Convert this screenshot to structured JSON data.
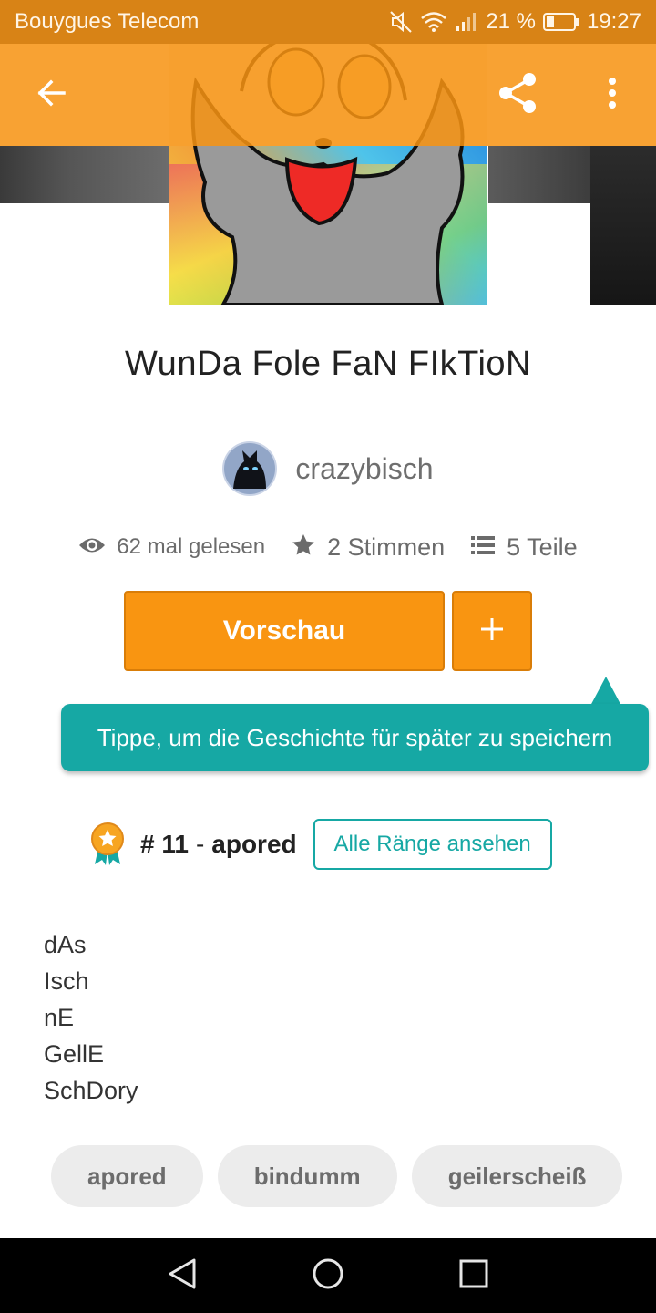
{
  "status_bar": {
    "carrier": "Bouygues Telecom",
    "battery_percent": "21 %",
    "time": "19:27"
  },
  "toolbar": {
    "back_icon": "arrow-left-icon",
    "share_icon": "share-icon",
    "more_icon": "more-vertical-icon"
  },
  "story": {
    "title": "WunDa Fole FaN FIkTioN",
    "author": "crazybisch",
    "reads": "62 mal gelesen",
    "votes": "2 Stimmen",
    "parts": "5 Teile"
  },
  "actions": {
    "preview_label": "Vorschau",
    "add_icon": "plus-icon"
  },
  "tooltip": {
    "text": "Tippe, um die Geschichte für später zu speichern"
  },
  "rank": {
    "number": "# 11",
    "separator": "-",
    "tag": "apored",
    "all_ranks_label": "Alle Ränge ansehen"
  },
  "description": {
    "lines": [
      "dAs",
      "Isch",
      "nE",
      "GellE",
      "SchDory"
    ]
  },
  "tags": [
    "apored",
    "bindumm",
    "geilerscheiß"
  ],
  "colors": {
    "accent_orange": "#f99511",
    "teal": "#16a8a4",
    "status_bar": "#d88316"
  }
}
